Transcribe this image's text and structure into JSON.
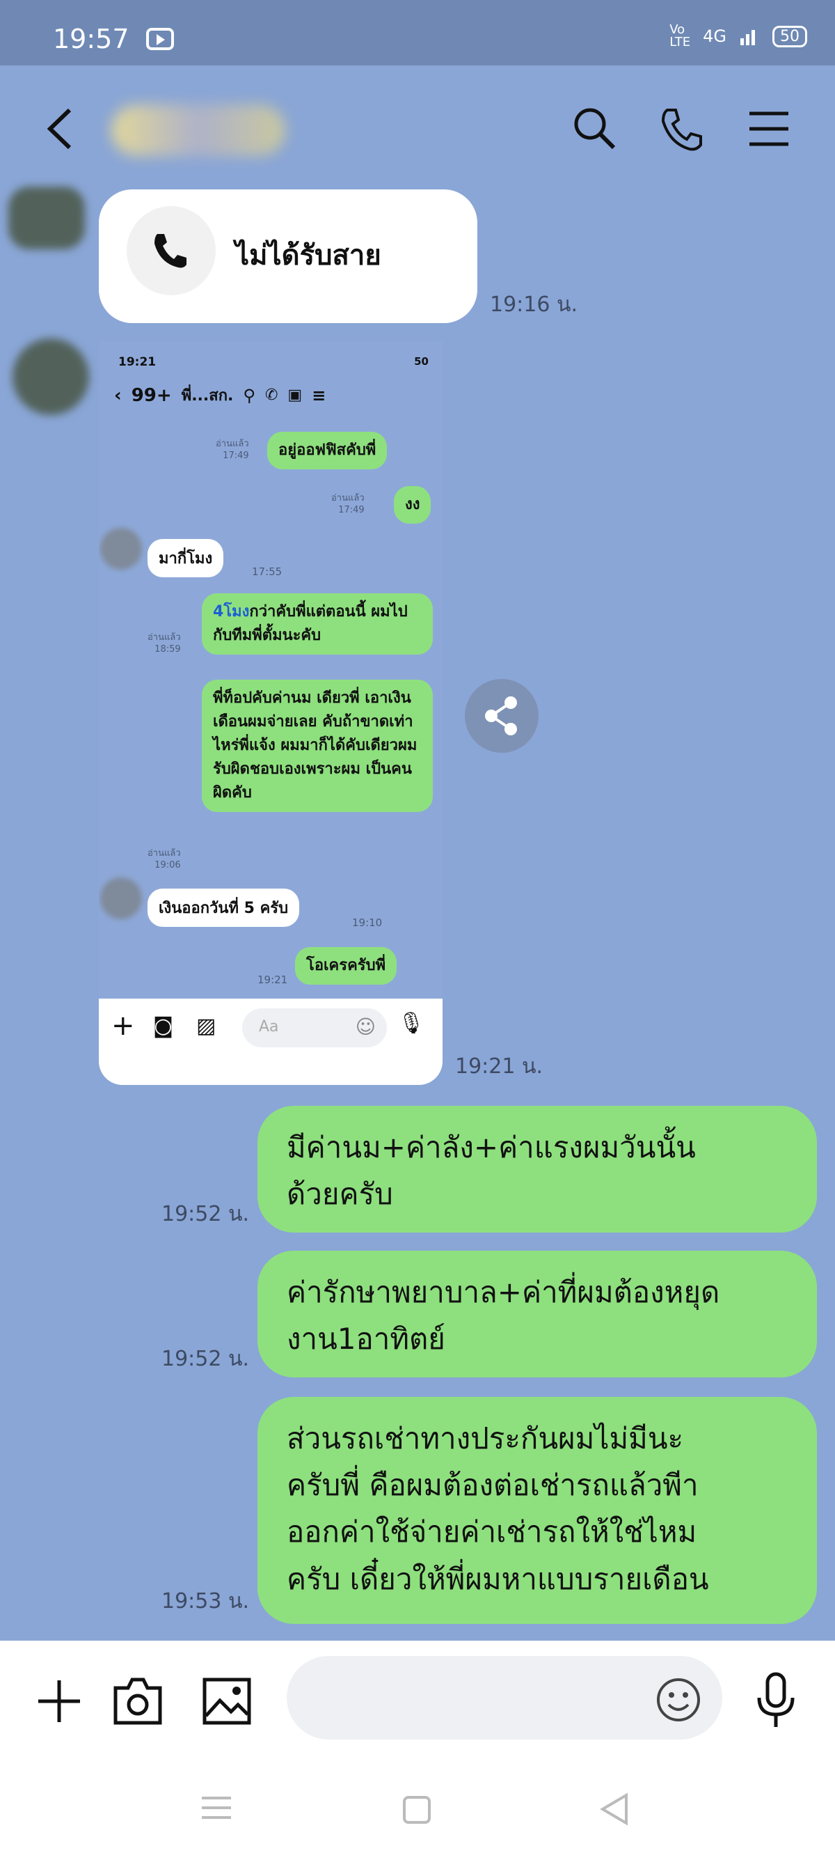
{
  "status_bar": {
    "time": "19:57",
    "network": "4G",
    "battery": "50"
  },
  "chat": {
    "missed_call": {
      "label": "ไม่ได้รับสาย",
      "time": "19:16 น."
    },
    "screenshot_msg": {
      "time": "19:21 น.",
      "status_time": "19:21",
      "status_right": "50",
      "back_count": "99+",
      "title": "พี่...สก.",
      "messages": [
        {
          "side": "right",
          "text": "อยู่ออฟฟิสคับพี่",
          "read": "อ่านแล้ว",
          "time": "17:49"
        },
        {
          "side": "right",
          "text": "งง",
          "read": "อ่านแล้ว",
          "time": "17:49"
        },
        {
          "side": "left",
          "text": "มากี่โมง",
          "time": "17:55"
        },
        {
          "side": "right",
          "link": "4โมง",
          "text": "กว่าคับพี่แต่ตอนนี้ ผมไปกับทีมพี่ตั้มนะคับ",
          "read": "อ่านแล้ว",
          "time": "18:59"
        },
        {
          "side": "right",
          "text": "พี่ท็อปคับค่านม เดียวพี่ เอาเงินเดือนผมจ่ายเลย คับถ้าขาดเท่าไหร่พี่แจ้ง ผมมาก็ได้คับเดียวผม รับผิดชอบเองเพราะผม เป็นคนผิดคับ",
          "read": "อ่านแล้ว",
          "time": "19:06"
        },
        {
          "side": "left",
          "text": "เงินออกวันที่ 5 ครับ",
          "time": "19:10"
        },
        {
          "side": "right",
          "text": "โอเครครับพี่",
          "time": "19:21"
        }
      ],
      "input_placeholder": "Aa"
    },
    "outgoing": [
      {
        "text": "มีค่านม+ค่าลัง+ค่าแรงผมวันนั้นด้วยครับ",
        "lines": [
          "มีค่านม+ค่าลัง+ค่าแรงผมวันนั้น",
          "ด้วยครับ"
        ],
        "time": "19:52 น."
      },
      {
        "text": "ค่ารักษาพยาบาล+ค่าที่ผมต้องหยุดงาน1อาทิตย์",
        "lines": [
          "ค่ารักษาพยาบาล+ค่าที่ผมต้องหยุด",
          "งาน1อาทิตย์"
        ],
        "time": "19:52 น."
      },
      {
        "text": "ส่วนรถเช่าทางประกันผมไม่มีนะครับพี่ คือผมต้องต่อเช่ารถแล้วพีาออกค่าใช้จ่ายค่าเช่ารถให้ใช่ไหมครับ เดี๋ยวให้พี่ผมหาแบบรายเดือน",
        "lines": [
          "ส่วนรถเช่าทางประกันผมไม่มีนะ",
          "ครับพี่ คือผมต้องต่อเช่ารถแล้วพีา",
          "ออกค่าใช้จ่ายค่าเช่ารถให้ใช่ไหม",
          "ครับ เดี๋ยวให้พี่ผมหาแบบรายเดือน"
        ],
        "time": "19:53 น."
      }
    ]
  },
  "colors": {
    "background": "#8aa6d6",
    "bubble_green": "#8ee07e",
    "status_bar": "#6f89b4"
  }
}
